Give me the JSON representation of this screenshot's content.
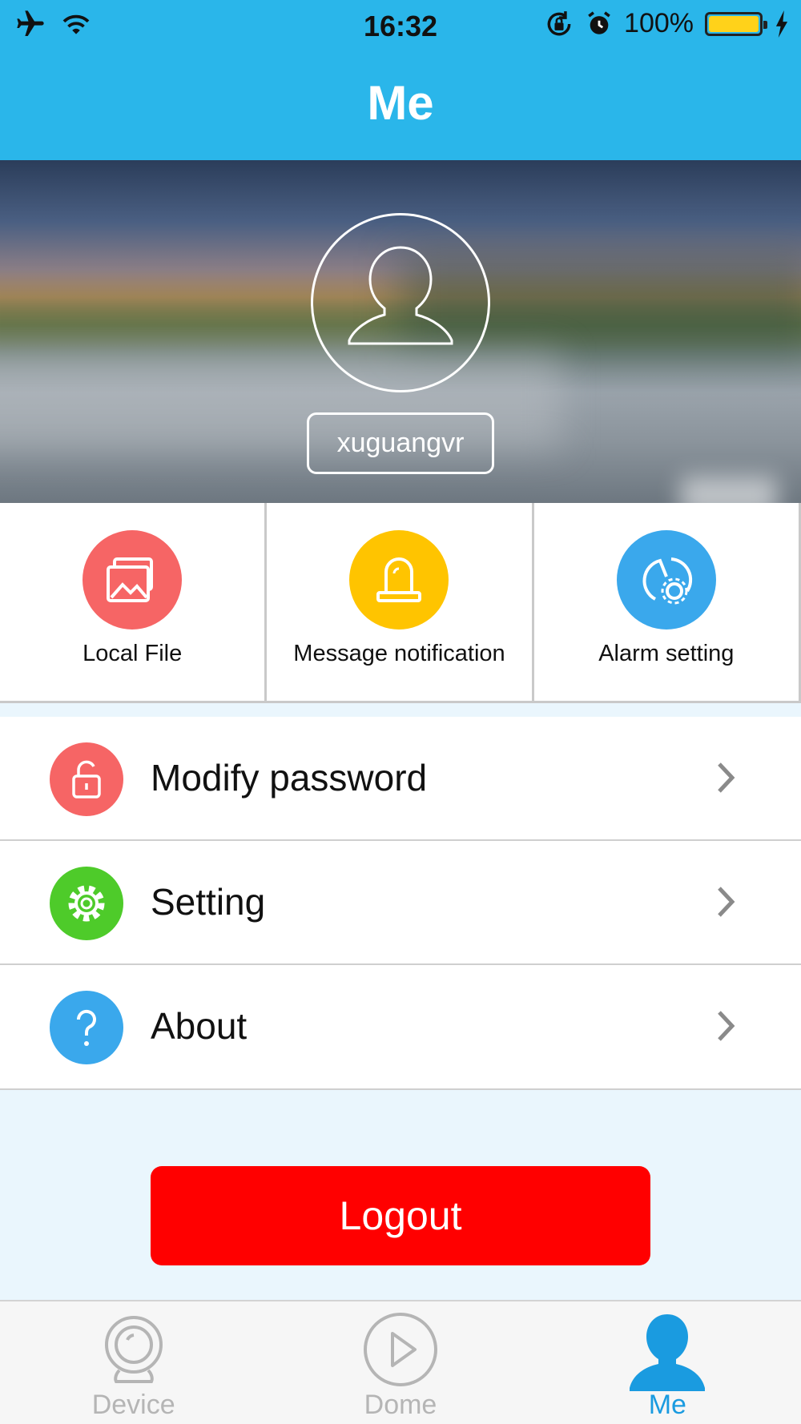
{
  "status_bar": {
    "time": "16:32",
    "battery_text": "100%",
    "battery_level": 1.0,
    "icons": [
      "airplane-icon",
      "wifi-icon",
      "rotation-lock-icon",
      "alarm-icon",
      "battery-icon",
      "charging-icon"
    ]
  },
  "nav": {
    "title": "Me"
  },
  "profile": {
    "username": "xuguangvr"
  },
  "quick_actions": [
    {
      "label": "Local File",
      "icon": "gallery-icon",
      "color": "#f66565"
    },
    {
      "label": "Message notification",
      "icon": "siren-icon",
      "color": "#ffc400"
    },
    {
      "label": "Alarm setting",
      "icon": "alarm-gear-icon",
      "color": "#3aa8ec"
    }
  ],
  "menu": [
    {
      "label": "Modify password",
      "icon": "lock-icon",
      "color": "#f66565"
    },
    {
      "label": "Setting",
      "icon": "gear-icon",
      "color": "#4ecb2a"
    },
    {
      "label": "About",
      "icon": "question-icon",
      "color": "#3aa8ec"
    }
  ],
  "logout": {
    "label": "Logout",
    "color": "#ff0000"
  },
  "tabs": [
    {
      "label": "Device",
      "icon": "camera-icon",
      "active": false
    },
    {
      "label": "Dome",
      "icon": "play-icon",
      "active": false
    },
    {
      "label": "Me",
      "icon": "person-icon",
      "active": true
    }
  ],
  "colors": {
    "accent": "#2ab6ea",
    "active_tab": "#1a9be0"
  }
}
